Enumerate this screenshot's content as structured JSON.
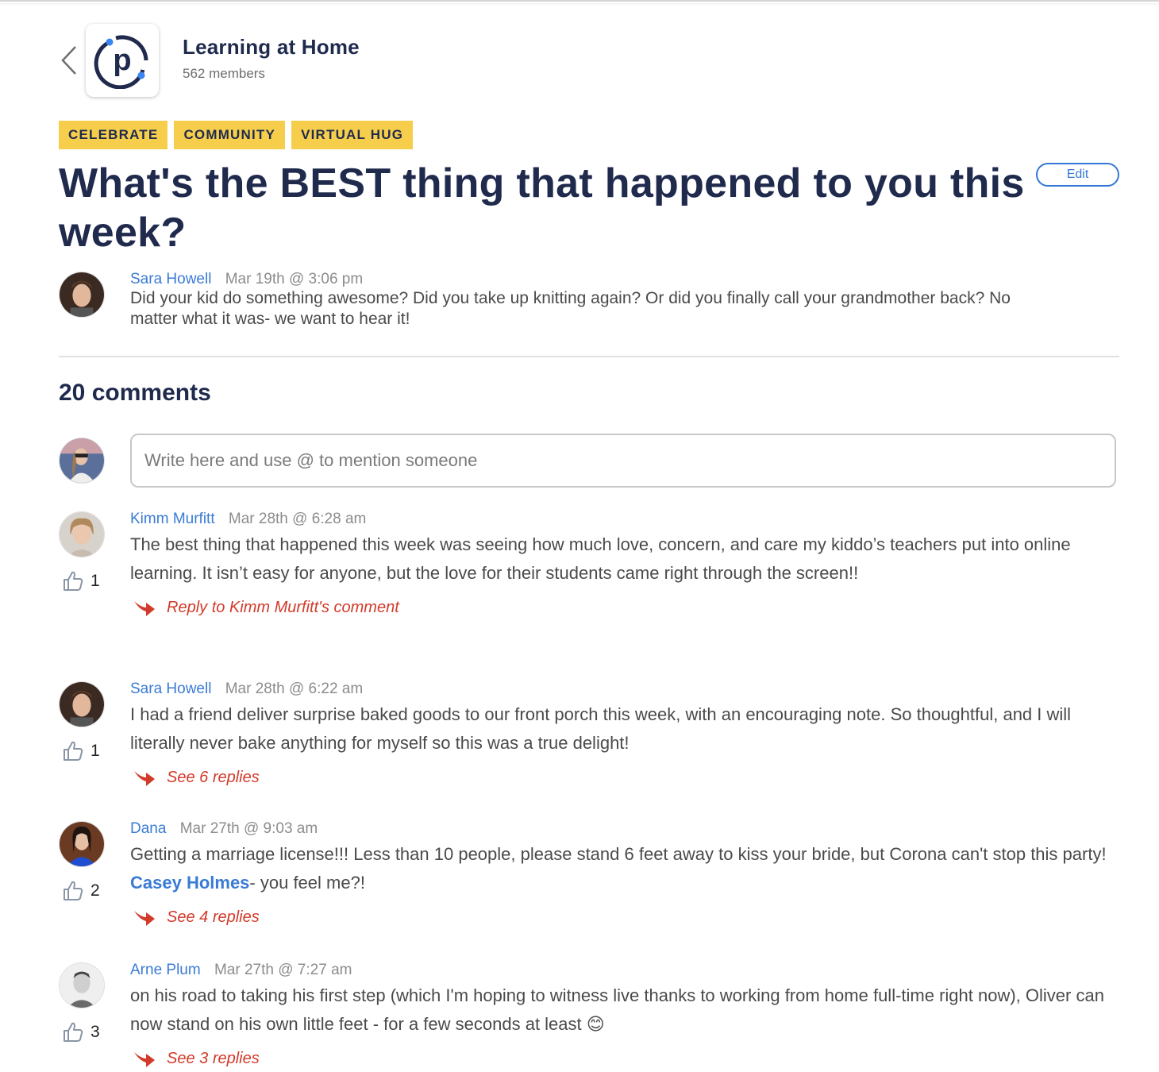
{
  "header": {
    "back_label": "Back",
    "group_title": "Learning at Home",
    "members": "562 members"
  },
  "tags": [
    "CELEBRATE",
    "COMMUNITY",
    "VIRTUAL HUG"
  ],
  "post": {
    "title": "What's the BEST thing that happened to you this week?",
    "edit_label": "Edit",
    "author": "Sara Howell",
    "timestamp": "Mar 19th @ 3:06 pm",
    "body": "Did your kid do something awesome? Did you take up knitting again? Or did you finally call your grandmother back? No matter what it was- we want to hear it!"
  },
  "comments_section": {
    "count_label": "20 comments",
    "composer_placeholder": "Write here and use @ to mention someone"
  },
  "comments": [
    {
      "author": "Kimm Murfitt",
      "timestamp": "Mar 28th @ 6:28 am",
      "text": "The best thing that happened this week was seeing how much love, concern, and care my kiddo’s teachers put into online learning. It isn’t easy for anyone, but the love for their students came right through the screen!!",
      "likes": "1",
      "reply_label": "Reply to Kimm Murfitt's comment"
    },
    {
      "author": "Sara Howell",
      "timestamp": "Mar 28th @ 6:22 am",
      "text": "I had a friend deliver surprise baked goods to our front porch this week, with an encouraging note. So thoughtful, and I will literally never bake anything for myself so this was a true delight!",
      "likes": "1",
      "reply_label": "See 6 replies"
    },
    {
      "author": "Dana",
      "timestamp": "Mar 27th @ 9:03 am",
      "text_before": "Getting a marriage license!!! Less than 10 people, please stand 6 feet away to kiss your bride, but Corona can't stop this party! ",
      "mention": "Casey Holmes",
      "text_after": "- you feel me?!",
      "likes": "2",
      "reply_label": "See 4 replies"
    },
    {
      "author": "Arne Plum",
      "timestamp": "Mar 27th @ 7:27 am",
      "text": "on his road to taking his first step (which I'm hoping to witness live thanks to working from home full-time right now), Oliver can now stand on his own little feet - for a few seconds at least",
      "emoji": "😊",
      "likes": "3",
      "reply_label": "See 3 replies"
    }
  ],
  "colors": {
    "navy": "#1f2a4d",
    "link_blue": "#3a7bd5",
    "tag_yellow": "#f6ce4c",
    "reply_red": "#d23a2a"
  }
}
